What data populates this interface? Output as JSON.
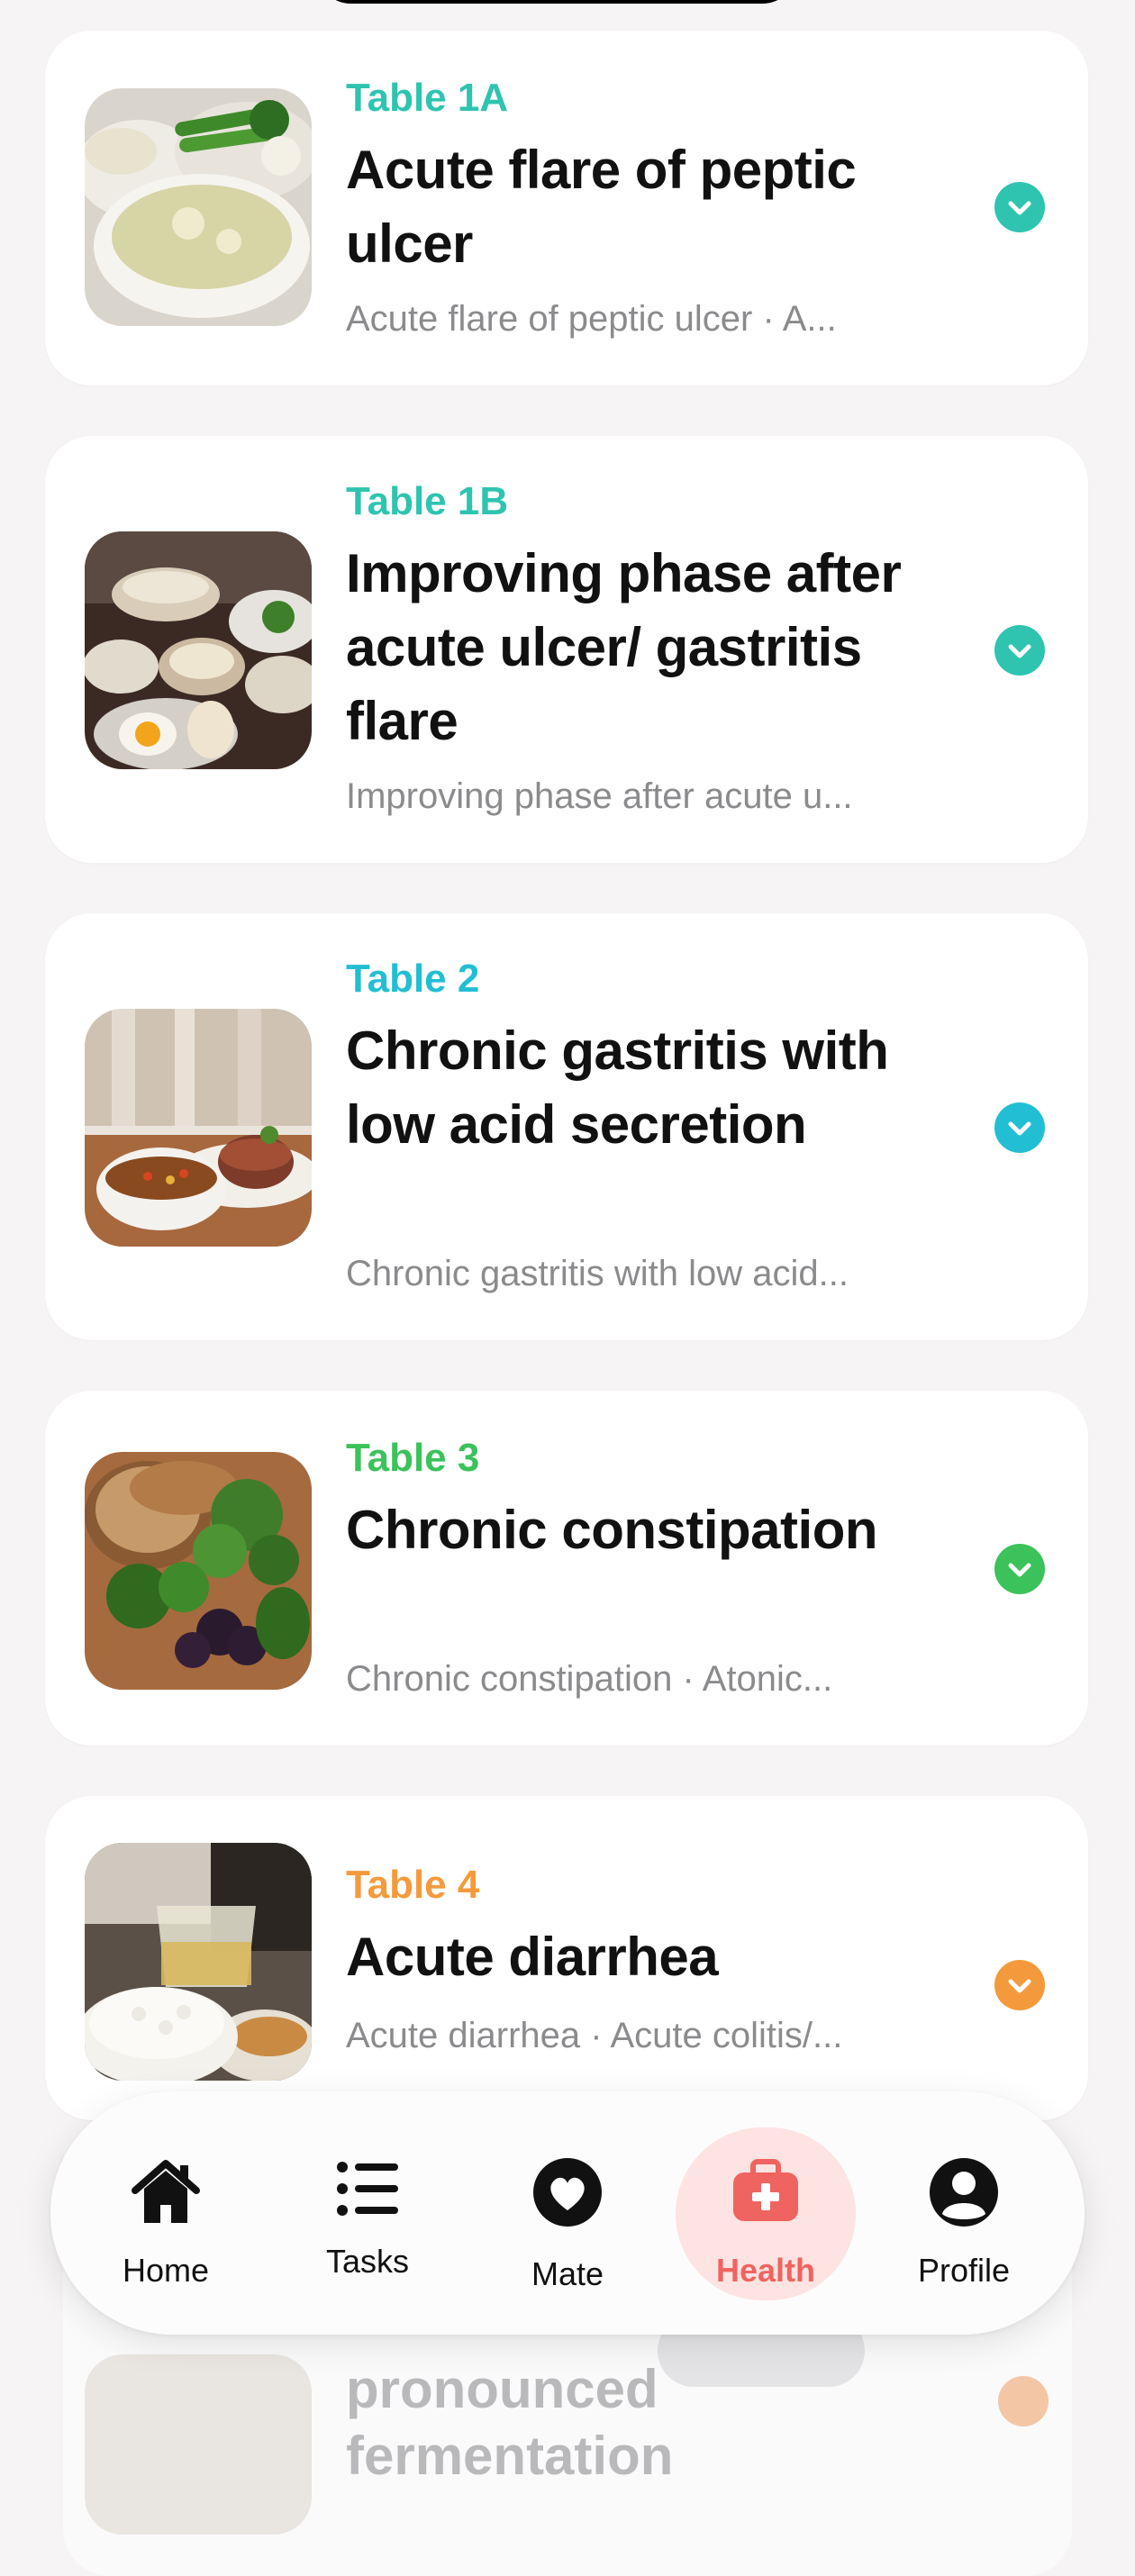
{
  "cards": [
    {
      "tag": "Table 1A",
      "title": "Acute flare of peptic ulcer",
      "subtitle": "Acute flare of peptic ulcer · A...",
      "accent": "#2ec4b0"
    },
    {
      "tag": "Table 1B",
      "title": "Improving phase after acute ulcer/ gastritis flare",
      "subtitle": "Improving phase after acute u...",
      "accent": "#2ec4b0"
    },
    {
      "tag": "Table 2",
      "title": "Chronic gastritis with low acid secretion",
      "subtitle": "Chronic gastritis with low acid...",
      "accent": "#22bfd4"
    },
    {
      "tag": "Table 3",
      "title": "Chronic constipation",
      "subtitle": "Chronic constipation · Atonic...",
      "accent": "#3cc25a"
    },
    {
      "tag": "Table 4",
      "title": "Acute diarrhea",
      "subtitle": "Acute diarrhea · Acute colitis/...",
      "accent": "#f59a3c"
    }
  ],
  "partial_card": {
    "title_line1": "pronounced",
    "title_line2": "fermentation"
  },
  "tabbar": {
    "items": [
      {
        "label": "Home",
        "icon": "home-icon"
      },
      {
        "label": "Tasks",
        "icon": "list-icon"
      },
      {
        "label": "Mate",
        "icon": "heart-icon"
      },
      {
        "label": "Health",
        "icon": "medical-kit-icon",
        "active": true
      },
      {
        "label": "Profile",
        "icon": "person-icon"
      }
    ],
    "active_color": "#ef6460"
  }
}
